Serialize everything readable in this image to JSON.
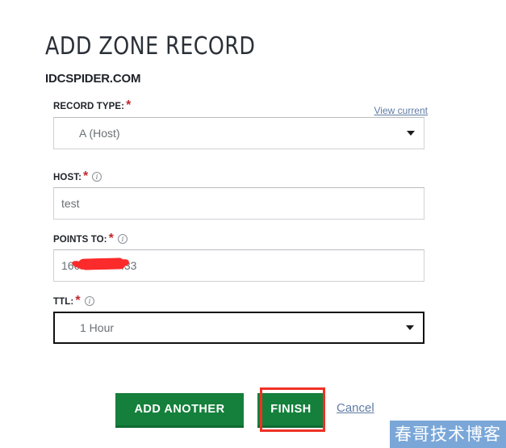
{
  "page": {
    "title": "ADD ZONE RECORD",
    "domain": "IDCSPIDER.COM"
  },
  "links": {
    "view_current": "View current",
    "cancel": "Cancel"
  },
  "fields": {
    "record_type": {
      "label": "RECORD TYPE:",
      "required_marker": "*",
      "value": "A (Host)",
      "icon": "chevron-down-icon"
    },
    "host": {
      "label": "HOST:",
      "required_marker": "*",
      "value": "test",
      "info_icon": "info-icon"
    },
    "points_to": {
      "label": "POINTS TO:",
      "required_marker": "*",
      "value_prefix": "160.",
      "value_suffix": ".33",
      "redacted": true,
      "info_icon": "info-icon"
    },
    "ttl": {
      "label": "TTL:",
      "required_marker": "*",
      "value": "1 Hour",
      "focused": true,
      "info_icon": "info-icon",
      "icon": "chevron-down-icon"
    }
  },
  "buttons": {
    "add_another": "ADD ANOTHER",
    "finish": "FINISH"
  },
  "annotation": {
    "highlight_color": "#ef3124",
    "redaction_color": "#fb2b2b"
  },
  "watermark": {
    "text": "春哥技术博客",
    "background": "#7aa7d8"
  },
  "colors": {
    "button_green": "#14803b",
    "link_blue": "#5f7ba6",
    "required_red": "#c0272d",
    "title_dark": "#2b3038"
  }
}
